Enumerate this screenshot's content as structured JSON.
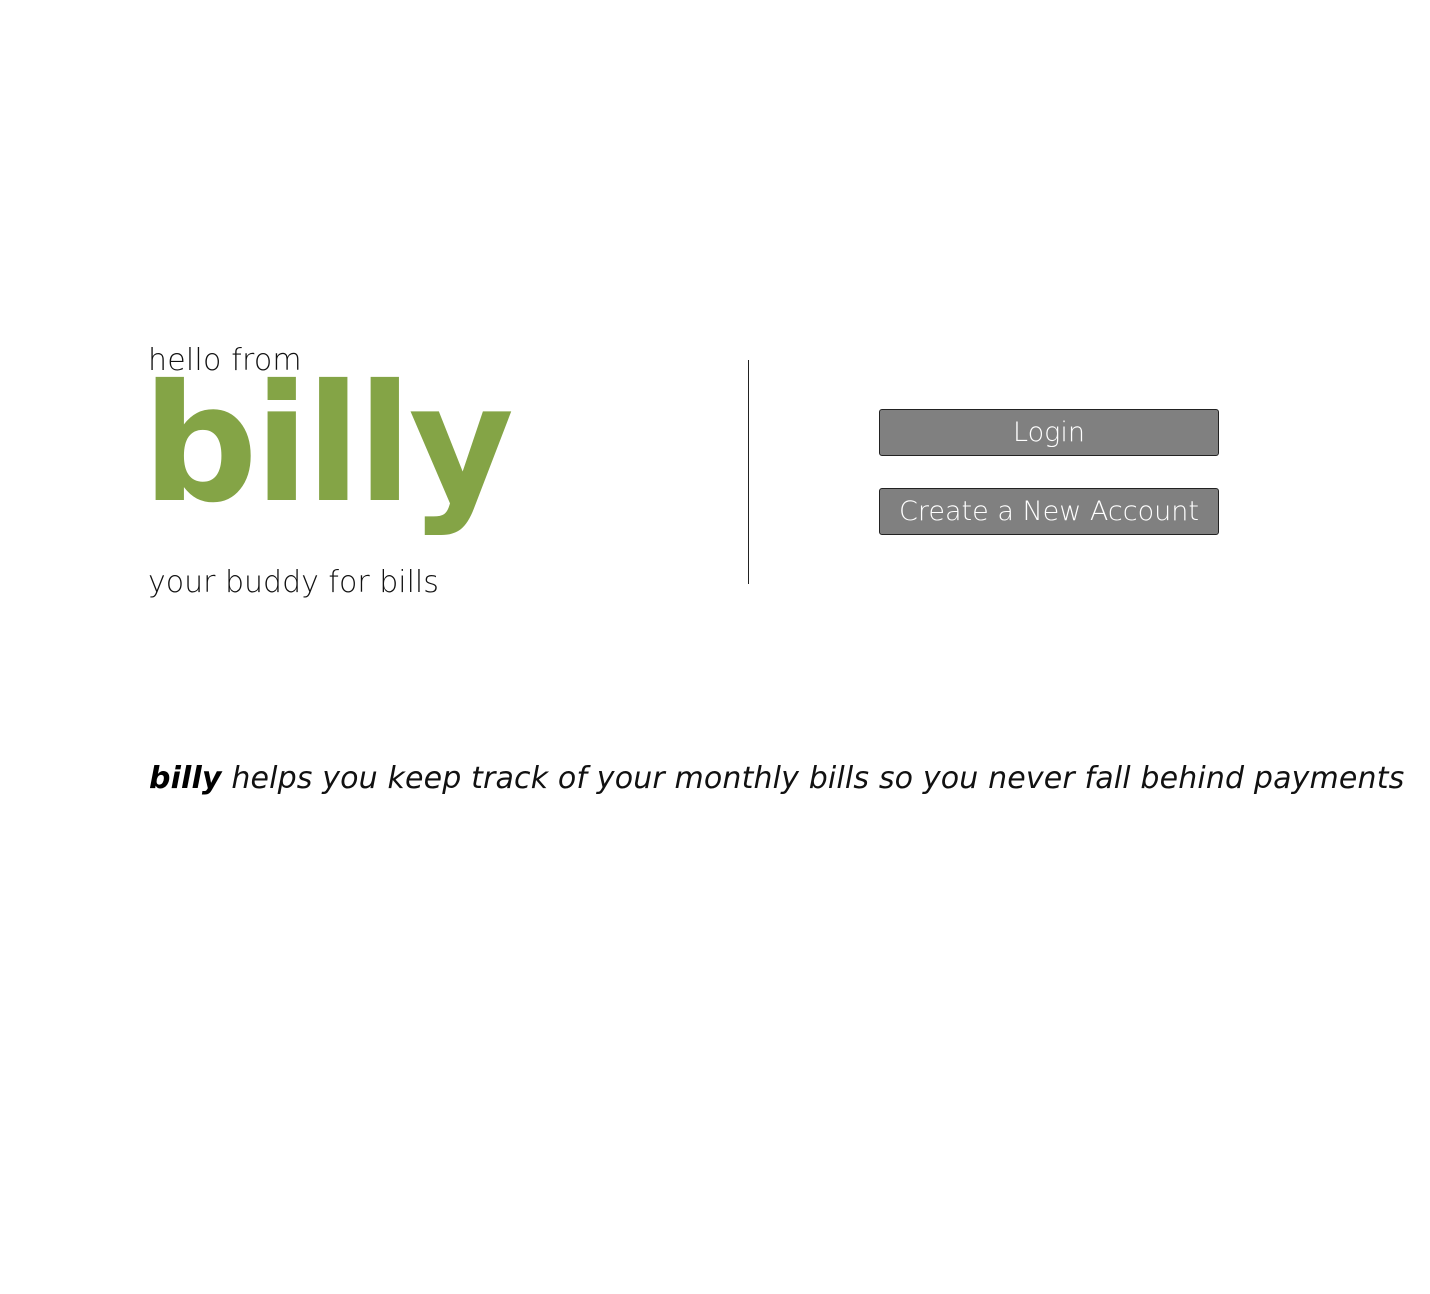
{
  "hero": {
    "greeting": "hello from",
    "logo_text": "billy",
    "tagline": "your buddy for bills"
  },
  "actions": {
    "login_label": "Login",
    "create_account_label": "Create a New Account"
  },
  "description": {
    "brand": "billy",
    "text": " helps you keep track of your monthly bills so you never fall behind payments"
  },
  "colors": {
    "brand": "#84a446",
    "button_bg": "#808080",
    "button_text": "#ffffff",
    "text": "#111111"
  }
}
